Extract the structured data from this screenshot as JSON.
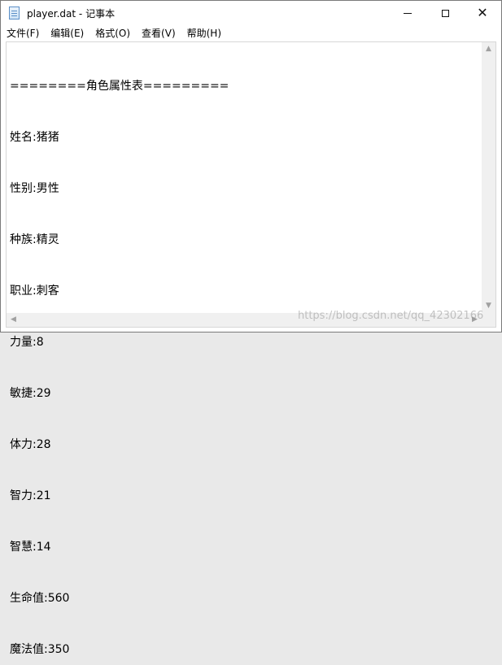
{
  "window": {
    "title": "player.dat - 记事本"
  },
  "controls": {
    "minimize": "minimize",
    "maximize": "maximize",
    "close": "✕"
  },
  "menu": [
    {
      "label": "文件(F)"
    },
    {
      "label": "编辑(E)"
    },
    {
      "label": "格式(O)"
    },
    {
      "label": "查看(V)"
    },
    {
      "label": "帮助(H)"
    }
  ],
  "content": {
    "lines": [
      "========角色属性表=========",
      "姓名:猪猪",
      "性别:男性",
      "种族:精灵",
      "职业:刺客",
      "力量:8",
      "敏捷:29",
      "体力:28",
      "智力:21",
      "智慧:14",
      "生命值:560",
      "魔法值:350"
    ]
  },
  "watermark": "https://blog.csdn.net/qq_42302166",
  "icons": {
    "app": "notepad-icon",
    "scroll_up": "▲",
    "scroll_down": "▼",
    "scroll_left": "◀",
    "scroll_right": "▶"
  }
}
